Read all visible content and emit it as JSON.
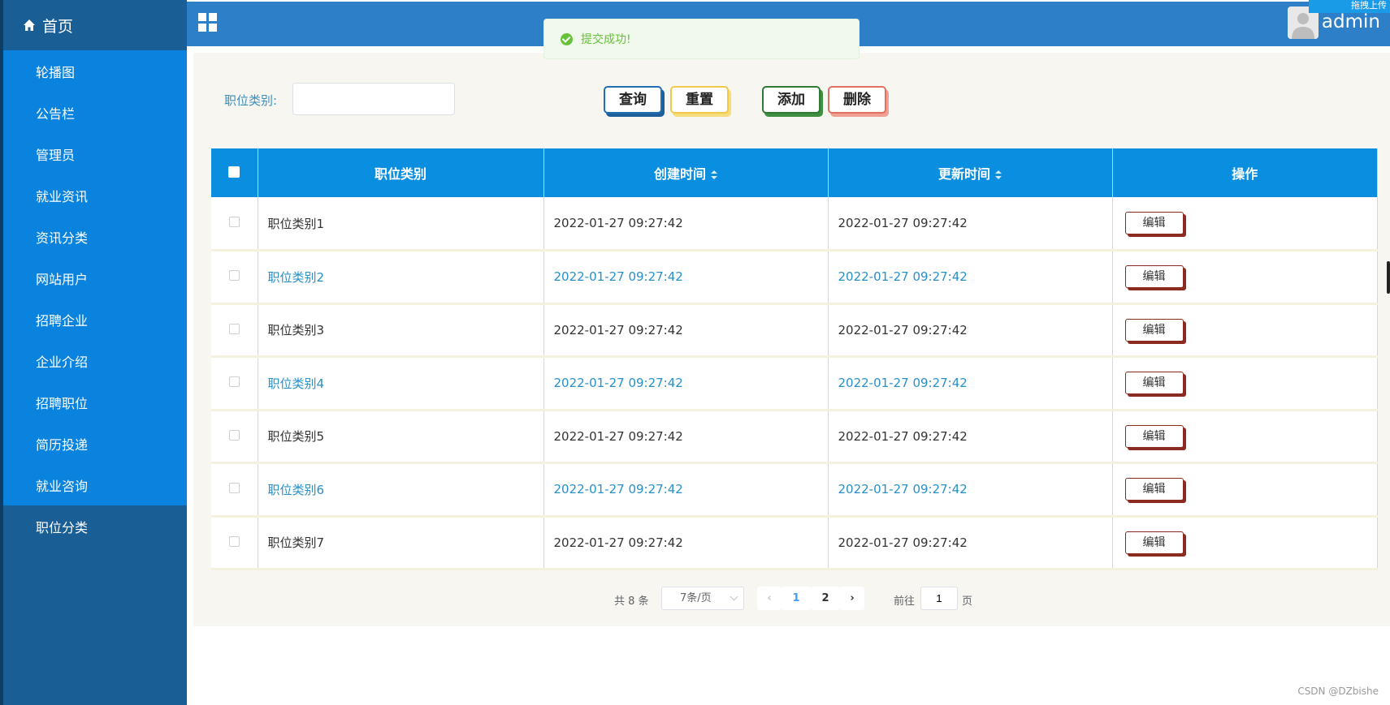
{
  "sidebar": {
    "home_label": "首页",
    "items": [
      {
        "label": "轮播图"
      },
      {
        "label": "公告栏"
      },
      {
        "label": "管理员"
      },
      {
        "label": "就业资讯"
      },
      {
        "label": "资讯分类"
      },
      {
        "label": "网站用户"
      },
      {
        "label": "招聘企业"
      },
      {
        "label": "企业介绍"
      },
      {
        "label": "招聘职位"
      },
      {
        "label": "简历投递"
      },
      {
        "label": "就业咨询"
      },
      {
        "label": "职位分类"
      }
    ]
  },
  "header": {
    "username": "admin",
    "corner_badge": "拖拽上传"
  },
  "toast": {
    "message": "提交成功!"
  },
  "filter": {
    "label": "职位类别:",
    "value": "",
    "buttons": {
      "query": "查询",
      "reset": "重置",
      "add": "添加",
      "delete": "删除"
    }
  },
  "table": {
    "columns": {
      "category": "职位类别",
      "created": "创建时间",
      "updated": "更新时间",
      "actions": "操作"
    },
    "edit_label": "编辑",
    "rows": [
      {
        "category": "职位类别1",
        "created": "2022-01-27 09:27:42",
        "updated": "2022-01-27 09:27:42"
      },
      {
        "category": "职位类别2",
        "created": "2022-01-27 09:27:42",
        "updated": "2022-01-27 09:27:42"
      },
      {
        "category": "职位类别3",
        "created": "2022-01-27 09:27:42",
        "updated": "2022-01-27 09:27:42"
      },
      {
        "category": "职位类别4",
        "created": "2022-01-27 09:27:42",
        "updated": "2022-01-27 09:27:42"
      },
      {
        "category": "职位类别5",
        "created": "2022-01-27 09:27:42",
        "updated": "2022-01-27 09:27:42"
      },
      {
        "category": "职位类别6",
        "created": "2022-01-27 09:27:42",
        "updated": "2022-01-27 09:27:42"
      },
      {
        "category": "职位类别7",
        "created": "2022-01-27 09:27:42",
        "updated": "2022-01-27 09:27:42"
      }
    ]
  },
  "pagination": {
    "total": "共 8 条",
    "page_size": "7条/页",
    "pages": [
      "1",
      "2"
    ],
    "current_page": "1",
    "goto_label": "前往",
    "goto_value": "1",
    "page_unit": "页"
  },
  "watermark": "CSDN @DZbishe"
}
